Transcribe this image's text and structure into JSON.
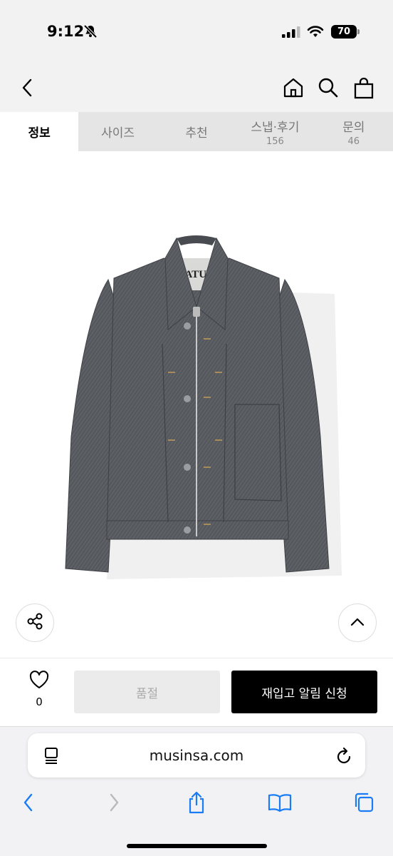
{
  "status_bar": {
    "time": "9:12",
    "battery": "70"
  },
  "tabs": [
    {
      "label": "정보",
      "count": ""
    },
    {
      "label": "사이즈",
      "count": ""
    },
    {
      "label": "추천",
      "count": ""
    },
    {
      "label": "스냅·후기",
      "count": "156"
    },
    {
      "label": "문의",
      "count": "46"
    }
  ],
  "product": {
    "label_text": "SATUR"
  },
  "buy_bar": {
    "like_count": "0",
    "soldout_label": "품절",
    "restock_label": "재입고 알림 신청"
  },
  "browser": {
    "url": "musinsa.com"
  },
  "colors": {
    "accent": "#000000",
    "link_blue": "#1a7cf5",
    "disabled_bg": "#ebebeb"
  }
}
